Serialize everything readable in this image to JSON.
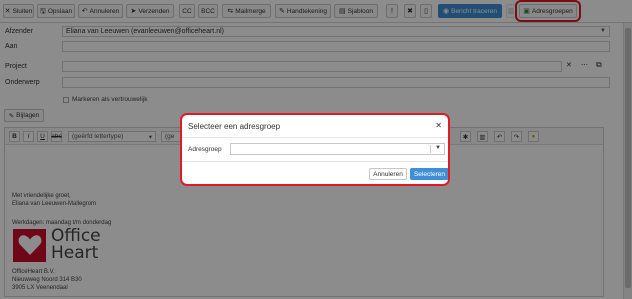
{
  "toolbar": {
    "buttons": [
      {
        "label": "Sluiten",
        "icon": "close-icon",
        "glyph": "✕"
      },
      {
        "label": "Opslaan",
        "icon": "save-icon",
        "glyph": "🖫"
      },
      {
        "label": "Annuleren",
        "icon": "undo-icon",
        "glyph": "↶"
      },
      {
        "label": "Verzenden",
        "icon": "send-icon",
        "glyph": "➤"
      },
      {
        "label": "CC"
      },
      {
        "label": "BCC"
      },
      {
        "label": "Mailmerge",
        "icon": "mailmerge-icon",
        "glyph": "⇆"
      },
      {
        "label": "Handtekening",
        "icon": "signature-icon",
        "glyph": "✎"
      },
      {
        "label": "Sjabloon",
        "icon": "template-icon",
        "glyph": "▤"
      },
      {
        "label": "",
        "icon": "exclamation-icon",
        "glyph": "!"
      },
      {
        "label": "",
        "icon": "tools-icon",
        "glyph": "✖"
      },
      {
        "label": "",
        "icon": "document-icon",
        "glyph": "▯"
      },
      {
        "label": "Bericht traceren",
        "icon": "eye-icon",
        "glyph": "◉"
      },
      {
        "label": "",
        "icon": "trash-icon",
        "glyph": "▥"
      },
      {
        "label": "Adresgroepen",
        "icon": "address-book-icon",
        "glyph": "▣"
      }
    ]
  },
  "form": {
    "afzender_label": "Afzender",
    "afzender_value": "Eliana van Leeuwen (evanleeuwen@officeheart.nl)",
    "aan_label": "Aan",
    "project_label": "Project",
    "onderwerp_label": "Onderwerp",
    "vertrouwelijk_label": "Markeren als vertrouwelijk",
    "bijlagen_label": "Bijlagen"
  },
  "editor": {
    "font_placeholder": "(geërfd lettertype)",
    "size_placeholder": "(ge",
    "body": {
      "greeting": "Met vriendelijke groet,",
      "name": "Eliana van Leeuwen-Mallegrom",
      "workdays": "Werkdagen: maandag t/m donderdag",
      "company": "OfficeHeart B.V.",
      "street": "Nieuwweg Noord 314 B30",
      "city": "3905 LX Veenendaal"
    },
    "logo": {
      "line1": "Office",
      "line2": "Heart"
    }
  },
  "modal": {
    "title": "Selecteer een adresgroep",
    "field_label": "Adresgroep",
    "cancel_label": "Annuleren",
    "ok_label": "Selecteren"
  },
  "colors": {
    "accent": "#3f8fd6",
    "highlight": "#e01b24",
    "brand": "#c8102e"
  }
}
